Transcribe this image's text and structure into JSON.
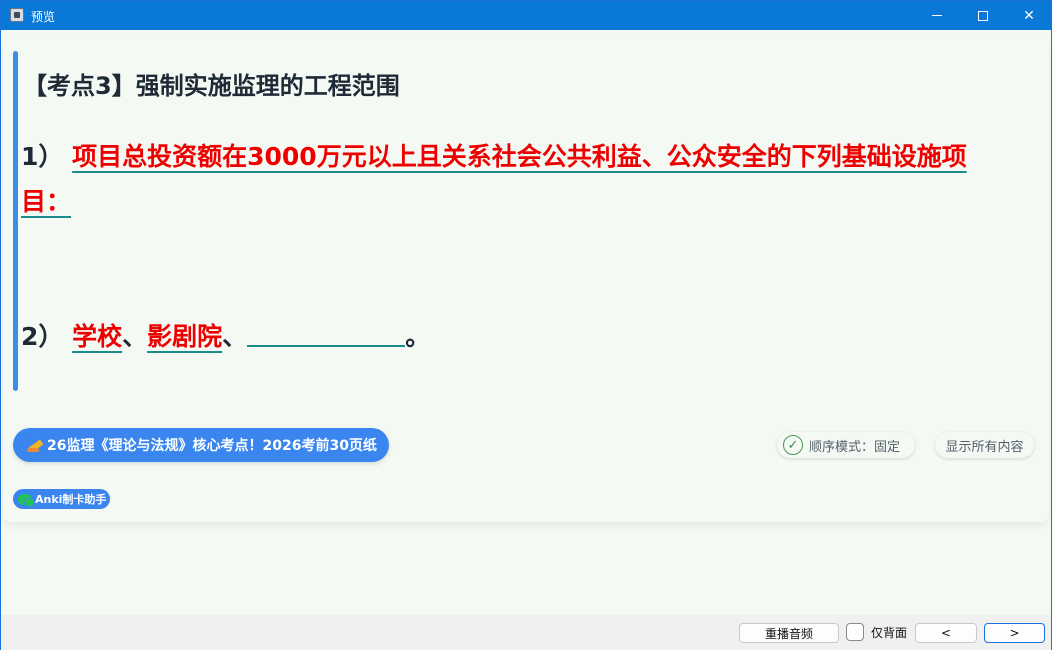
{
  "window": {
    "title": "预览"
  },
  "card": {
    "heading": "【考点3】强制实施监理的工程范围",
    "item1": {
      "number": "1）",
      "text": "项目总投资额在3000万元以上且关系社会公共利益、公众安全的下列基础设施项目："
    },
    "item2": {
      "number": "2）",
      "parts": [
        "学校",
        "影剧院"
      ],
      "separator": "、",
      "end": "。"
    }
  },
  "actions": {
    "promo_label": "26监理《理论与法规》核心考点！2026考前30页纸",
    "order_mode_label": "顺序模式：固定",
    "show_all_label": "显示所有内容",
    "anki_label": "Anki制卡助手"
  },
  "bottombar": {
    "replay_label": "重播音频",
    "back_only_label": "仅背面",
    "prev_label": "<",
    "next_label": ">"
  },
  "colors": {
    "titlebar": "#0a78d7",
    "accent_blue": "#3a86ee",
    "answer_red": "#ee0000",
    "underline_teal": "#1a8c8c"
  }
}
